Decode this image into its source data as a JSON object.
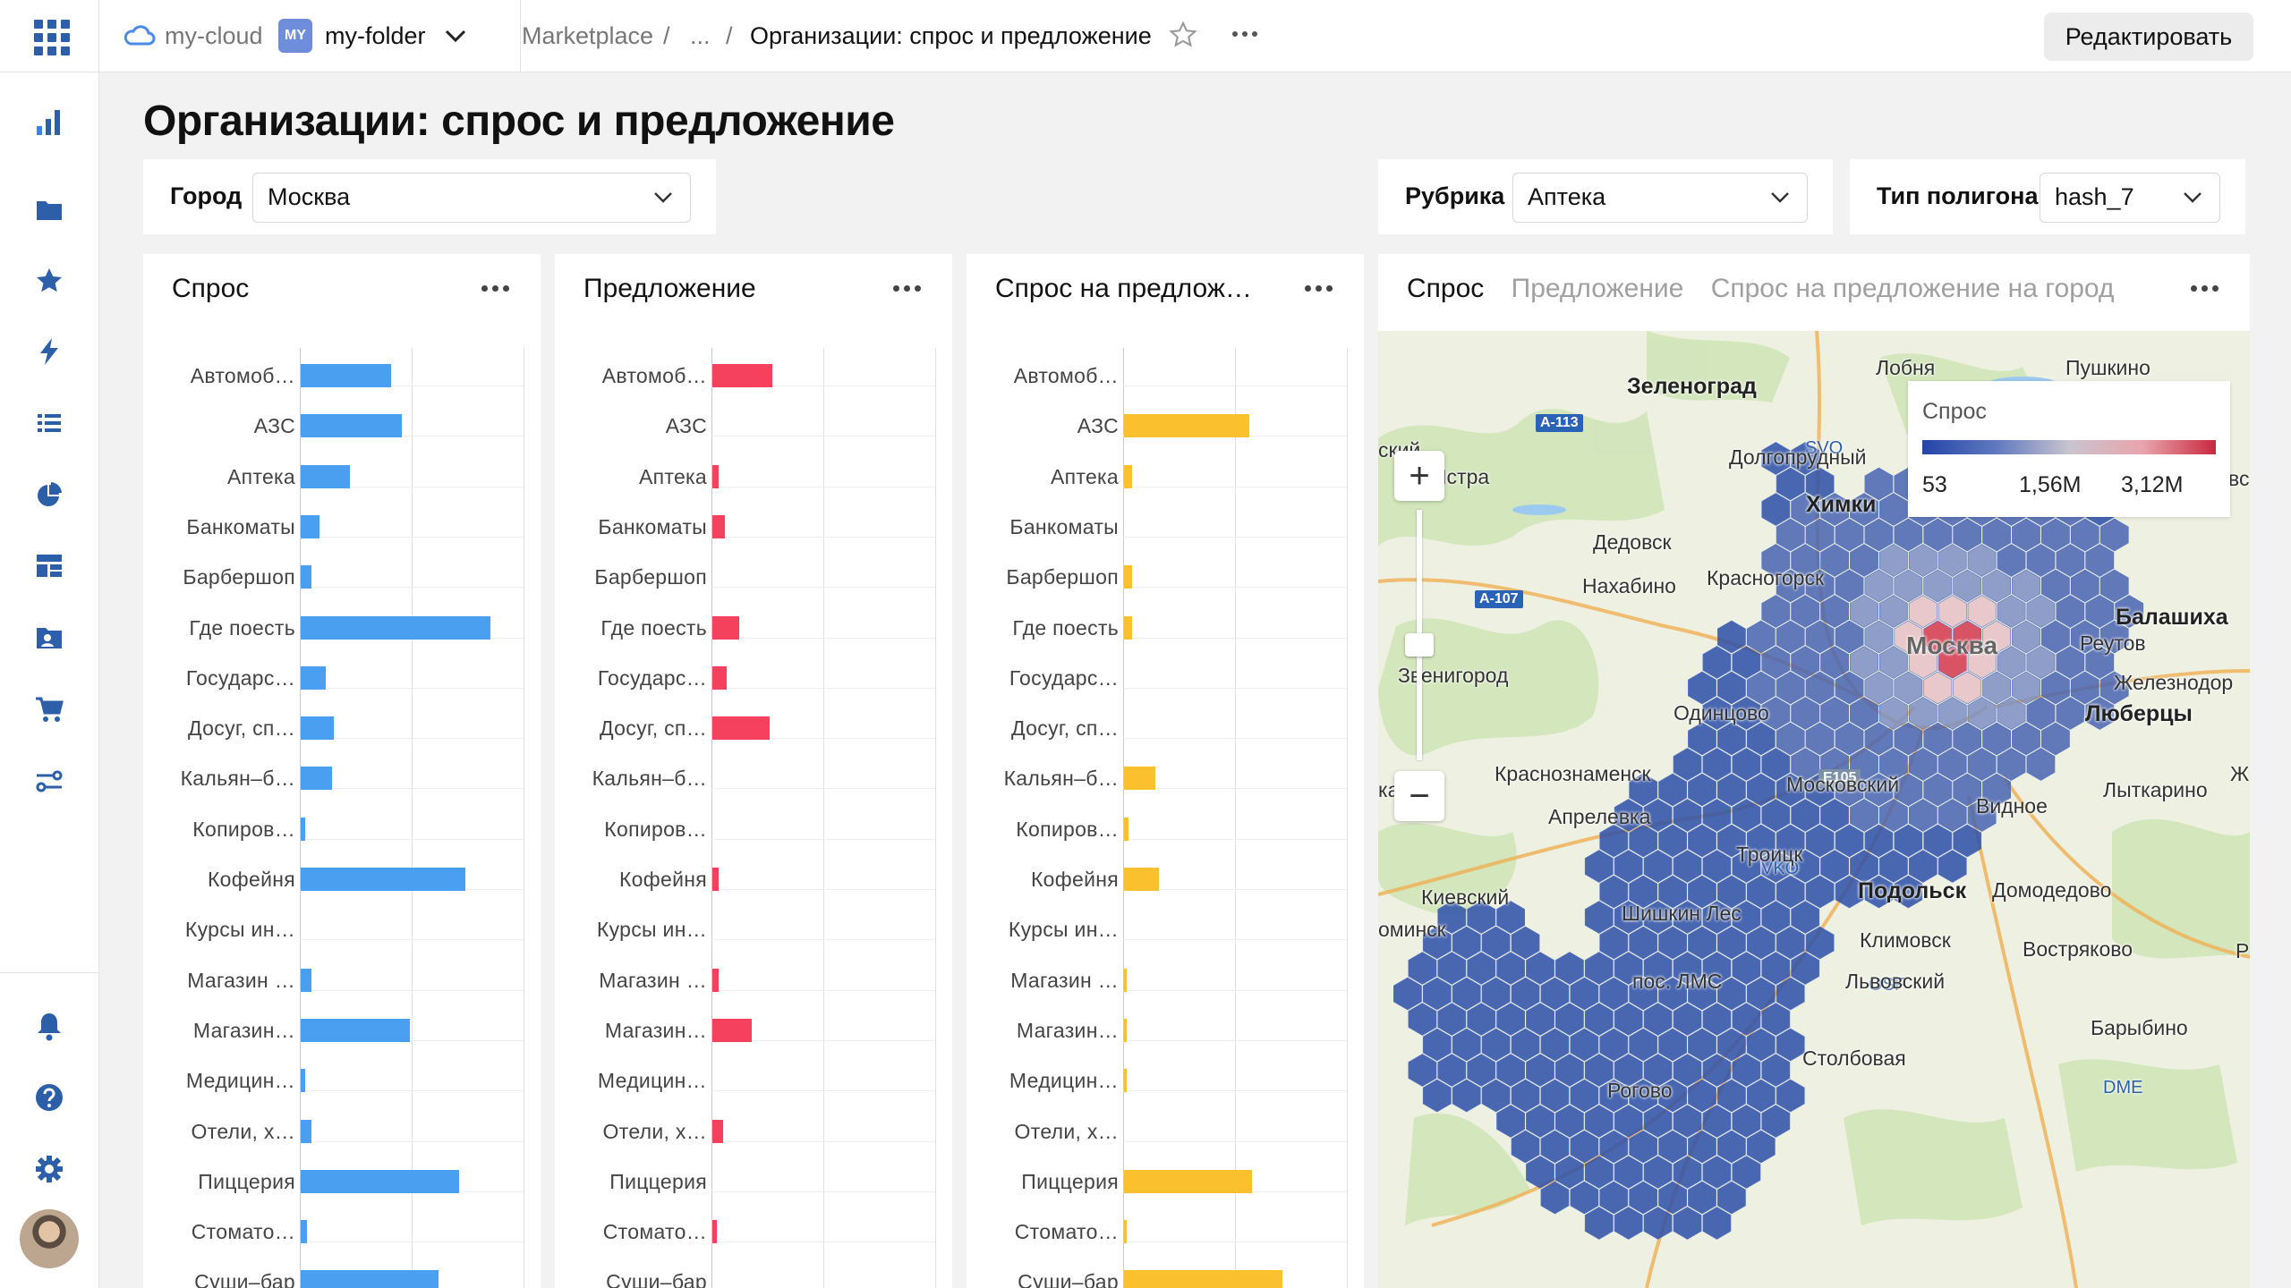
{
  "nav": {
    "top_icons": [
      "apps-grid-icon"
    ],
    "items": [
      {
        "icon": "bar-chart-icon",
        "active": true
      },
      {
        "icon": "folder-icon"
      },
      {
        "icon": "star-icon"
      },
      {
        "icon": "lightning-icon"
      },
      {
        "icon": "list-icon"
      },
      {
        "icon": "pie-chart-icon"
      },
      {
        "icon": "dashboard-icon"
      },
      {
        "icon": "person-card-icon"
      },
      {
        "icon": "cart-icon"
      },
      {
        "icon": "connections-icon"
      }
    ],
    "bottom_items": [
      {
        "icon": "bell-icon"
      },
      {
        "icon": "help-icon"
      },
      {
        "icon": "settings-gear-icon"
      }
    ]
  },
  "topbar": {
    "cloud": "my-cloud",
    "folder_badge": "MY",
    "folder": "my-folder",
    "crumb_marketplace": "Marketplace",
    "crumb_sep": "/",
    "crumb_ellipsis": "...",
    "crumb_current": "Организации: спрос и предложение",
    "edit_label": "Редактировать"
  },
  "page": {
    "title": "Организации: спрос и предложение"
  },
  "filters": {
    "city": {
      "label": "Город",
      "value": "Москва"
    },
    "rubric": {
      "label": "Рубрика",
      "value": "Аптека"
    },
    "polygon": {
      "label": "Тип полигона",
      "value": "hash_7"
    }
  },
  "colors": {
    "accent": "#2d5fa8",
    "bar_demand": "#4a9ff0",
    "bar_supply": "#f5405e",
    "bar_ratio": "#fbc02d"
  },
  "chart_data": [
    {
      "type": "bar",
      "orientation": "horizontal",
      "title": "Спрос",
      "categories": [
        "Автомоб…",
        "АЗС",
        "Аптека",
        "Банкоматы",
        "Барбершоп",
        "Где поесть",
        "Государс…",
        "Досуг, сп…",
        "Кальян–б…",
        "Копиров…",
        "Кофейня",
        "Курсы ин…",
        "Магазин …",
        "Магазин…",
        "Медицин…",
        "Отели, х…",
        "Пиццерия",
        "Стомато…",
        "Суши–бар"
      ],
      "values": [
        44,
        49,
        24,
        9,
        5,
        92,
        12,
        16,
        15,
        2,
        80,
        0,
        5,
        53,
        2,
        5,
        77,
        3,
        67
      ],
      "xlim": [
        0,
        100
      ]
    },
    {
      "type": "bar",
      "orientation": "horizontal",
      "title": "Предложение",
      "categories": [
        "Автомоб…",
        "АЗС",
        "Аптека",
        "Банкоматы",
        "Барбершоп",
        "Где поесть",
        "Государс…",
        "Досуг, сп…",
        "Кальян–б…",
        "Копиров…",
        "Кофейня",
        "Курсы ин…",
        "Магазин …",
        "Магазин…",
        "Медицин…",
        "Отели, х…",
        "Пиццерия",
        "Стомато…",
        "Суши–бар"
      ],
      "values": [
        29,
        0,
        3,
        6,
        0,
        13,
        7,
        28,
        0,
        0,
        3,
        0,
        3,
        19,
        0,
        5,
        0,
        2,
        0
      ],
      "xlim": [
        0,
        100
      ]
    },
    {
      "type": "bar",
      "orientation": "horizontal",
      "title": "Спрос на предлож…",
      "categories": [
        "Автомоб…",
        "АЗС",
        "Аптека",
        "Банкоматы",
        "Барбершоп",
        "Где поесть",
        "Государс…",
        "Досуг, сп…",
        "Кальян–б…",
        "Копиров…",
        "Кофейня",
        "Курсы ин…",
        "Магазин …",
        "Магазин…",
        "Медицин…",
        "Отели, х…",
        "Пиццерия",
        "Стомато…",
        "Суши–бар"
      ],
      "values": [
        0,
        61,
        4,
        0,
        4,
        4,
        0,
        0,
        15,
        2,
        17,
        0,
        1,
        1,
        1,
        0,
        62,
        1,
        77
      ],
      "xlim": [
        0,
        100
      ]
    }
  ],
  "map_panel": {
    "tabs": [
      "Спрос",
      "Предложение",
      "Спрос на предложение на город"
    ],
    "active_tab": 0,
    "legend": {
      "title": "Спрос",
      "min": "53",
      "mid": "1,56M",
      "max": "3,12M"
    },
    "zoom_in": "+",
    "zoom_out": "−",
    "roads": [
      "A-113",
      "A-107",
      "E105"
    ],
    "airports": [
      "SVO",
      "VKO",
      "OSF",
      "DME"
    ],
    "labels": [
      "Зеленоград",
      "Лобня",
      "Пушкино",
      "ский",
      "Истра",
      "Долгопрудный",
      "Химки",
      "Дедовск",
      "Красногорск",
      "Нахабино",
      "Балашиха",
      "Москва",
      "Реутов",
      "Звенигород",
      "Железнодор",
      "Одинцово",
      "Люберцы",
      "Краснознаменск",
      "Московский",
      "Ж",
      "Лыткарино",
      "ка",
      "Апрелевка",
      "Видное",
      "Троицк",
      "Киевский",
      "Подольск",
      "Домодедово",
      "Шишкин Лес",
      "оминск",
      "Климовск",
      "Востряково",
      "Р",
      "пос. ЛМС",
      "Львовский",
      "Барыбино",
      "Столбовая",
      "Рогово",
      "вс"
    ]
  }
}
